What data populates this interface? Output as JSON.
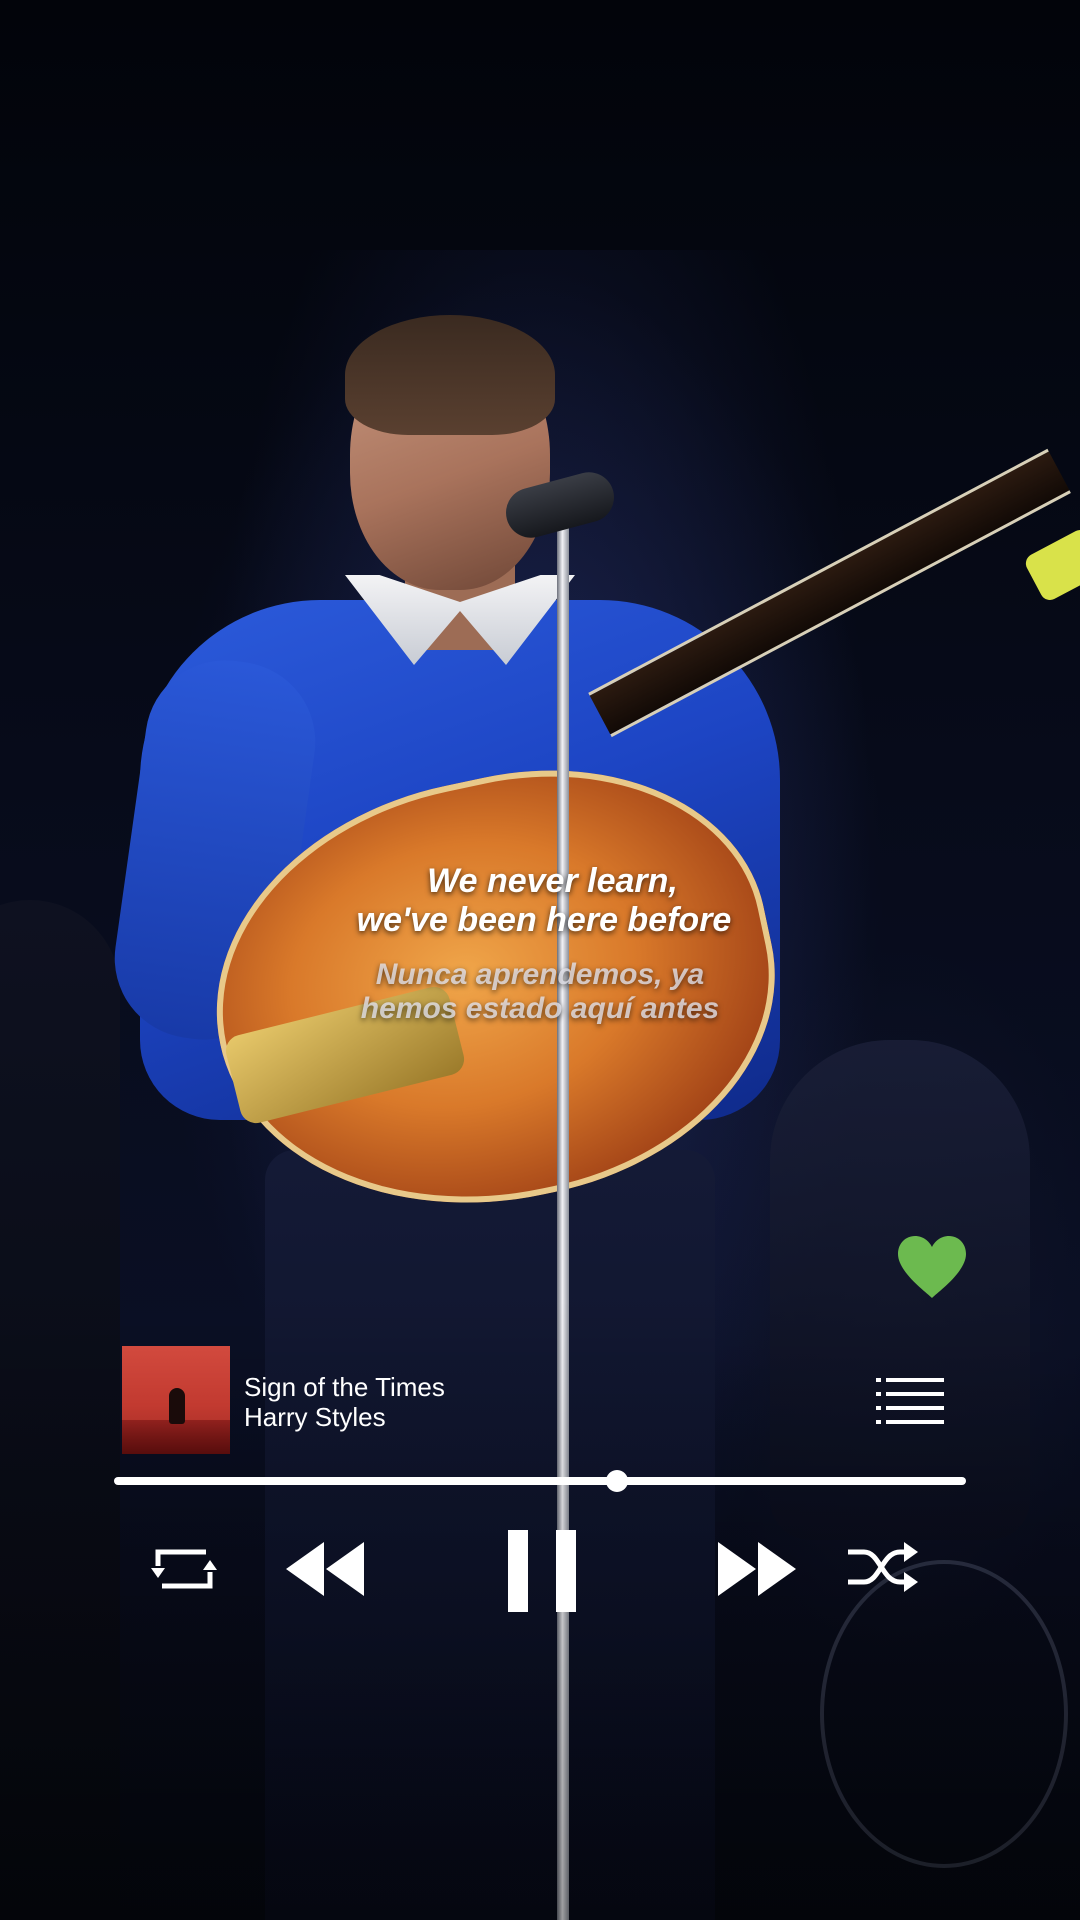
{
  "lyrics": {
    "line_1": "We never learn,",
    "line_2": "we've been here before",
    "translation_line_1": "Nunca aprendemos, ya",
    "translation_line_2": "hemos estado aquí antes"
  },
  "like": {
    "icon": "heart-icon",
    "liked": true,
    "color": "#6cba4f"
  },
  "now_playing": {
    "title": "Sign of the Times",
    "artist": "Harry Styles",
    "queue_icon": "queue-list-icon"
  },
  "playback": {
    "progress_fraction": 0.59,
    "state": "playing"
  },
  "controls": {
    "repeat_icon": "repeat-icon",
    "previous_icon": "rewind-icon",
    "pause_icon": "pause-icon",
    "next_icon": "fast-forward-icon",
    "shuffle_icon": "shuffle-icon"
  },
  "colors": {
    "foreground": "#ffffff",
    "accent": "#6cba4f"
  }
}
